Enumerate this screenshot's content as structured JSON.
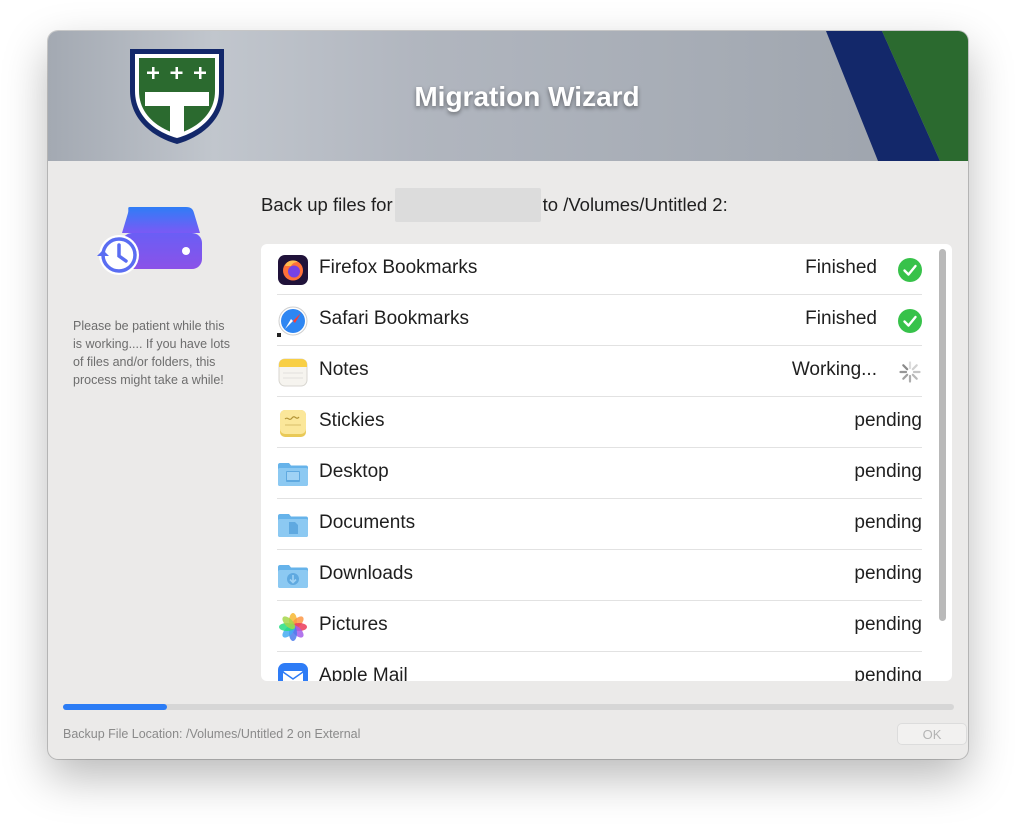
{
  "window": {
    "title": "Migration Wizard"
  },
  "sidebar": {
    "patience_text": "Please be patient while this is working.... If you have lots of files and/or folders, this process might take a while!"
  },
  "main": {
    "heading_prefix": "Back up files for",
    "heading_suffix": "to /Volumes/Untitled 2:",
    "items": [
      {
        "label": "Firefox Bookmarks",
        "status": "Finished",
        "icon": "firefox-icon",
        "state": "finished"
      },
      {
        "label": "Safari Bookmarks",
        "status": "Finished",
        "icon": "safari-icon",
        "state": "finished"
      },
      {
        "label": "Notes",
        "status": "Working...",
        "icon": "notes-icon",
        "state": "working"
      },
      {
        "label": "Stickies",
        "status": "pending",
        "icon": "stickies-icon",
        "state": "pending"
      },
      {
        "label": "Desktop",
        "status": "pending",
        "icon": "desktop-folder-icon",
        "state": "pending"
      },
      {
        "label": "Documents",
        "status": "pending",
        "icon": "documents-folder-icon",
        "state": "pending"
      },
      {
        "label": "Downloads",
        "status": "pending",
        "icon": "downloads-folder-icon",
        "state": "pending"
      },
      {
        "label": "Pictures",
        "status": "pending",
        "icon": "photos-icon",
        "state": "pending"
      },
      {
        "label": "Apple Mail",
        "status": "pending",
        "icon": "mail-icon",
        "state": "pending"
      }
    ]
  },
  "progress": {
    "fraction": 0.117
  },
  "footer": {
    "location_text": "Backup File Location: /Volumes/Untitled 2 on External",
    "ok_label": "OK"
  },
  "colors": {
    "accent": "#2b7cf5",
    "success": "#37c24a",
    "banner_navy": "#13286a",
    "banner_green": "#2b6a2f"
  }
}
